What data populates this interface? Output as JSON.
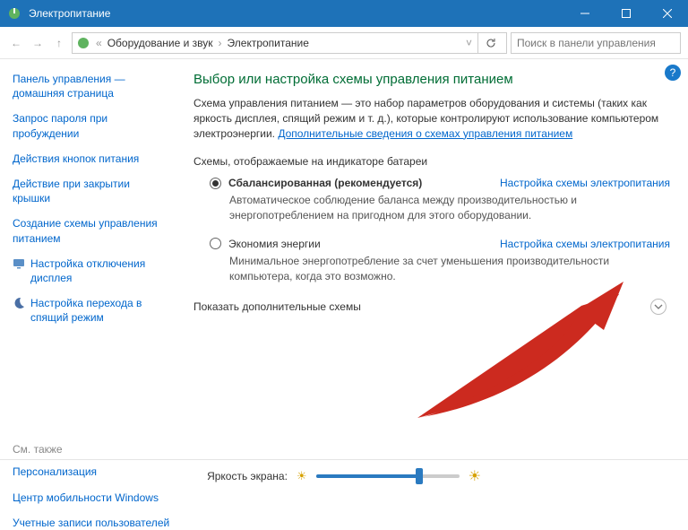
{
  "window": {
    "title": "Электропитание"
  },
  "breadcrumb": {
    "seg1": "Оборудование и звук",
    "seg2": "Электропитание"
  },
  "search": {
    "placeholder": "Поиск в панели управления"
  },
  "sidebar": {
    "home": "Панель управления — домашняя страница",
    "items": [
      "Запрос пароля при пробуждении",
      "Действия кнопок питания",
      "Действие при закрытии крышки",
      "Создание схемы управления питанием",
      "Настройка отключения дисплея",
      "Настройка перехода в спящий режим"
    ],
    "seealso_label": "См. также",
    "seealso": [
      "Персонализация",
      "Центр мобильности Windows",
      "Учетные записи пользователей"
    ]
  },
  "content": {
    "heading": "Выбор или настройка схемы управления питанием",
    "intro_text": "Схема управления питанием — это набор параметров оборудования и системы (таких как яркость дисплея, спящий режим и т. д.), которые контролируют использование компьютером электроэнергии. ",
    "intro_link": "Дополнительные сведения о схемах управления питанием",
    "section_label": "Схемы, отображаемые на индикаторе батареи",
    "plans": [
      {
        "name": "Сбалансированная (рекомендуется)",
        "bold": true,
        "checked": true,
        "link": "Настройка схемы электропитания",
        "desc": "Автоматическое соблюдение баланса между производительностью и энергопотреблением на пригодном для этого оборудовании."
      },
      {
        "name": "Экономия энергии",
        "bold": false,
        "checked": false,
        "link": "Настройка схемы электропитания",
        "desc": "Минимальное энергопотребление за счет уменьшения производительности компьютера, когда это возможно."
      }
    ],
    "expand_label": "Показать дополнительные схемы"
  },
  "bottom": {
    "label": "Яркость экрана:",
    "value_pct": 72
  }
}
